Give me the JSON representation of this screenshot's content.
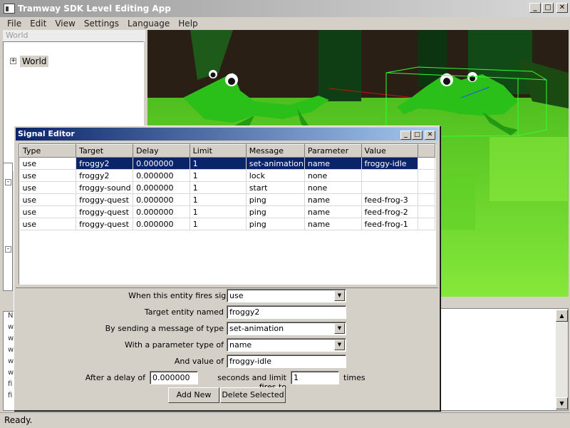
{
  "app": {
    "title": "Tramway SDK Level Editing App",
    "window_buttons": [
      "_",
      "□",
      "✕"
    ]
  },
  "menu": [
    "File",
    "Edit",
    "View",
    "Settings",
    "Language",
    "Help"
  ],
  "world_panel": {
    "title": "World",
    "tree_root": "World",
    "expander": "+"
  },
  "status": "Ready.",
  "dialog": {
    "title": "Signal Editor",
    "buttons": [
      "_",
      "□",
      "✕"
    ],
    "columns": [
      "Type",
      "Target",
      "Delay",
      "Limit",
      "Message",
      "Parameter",
      "Value"
    ],
    "rows": [
      [
        "use",
        "froggy2",
        "0.000000",
        "1",
        "set-animation",
        "name",
        "froggy-idle"
      ],
      [
        "use",
        "froggy2",
        "0.000000",
        "1",
        "lock",
        "none",
        ""
      ],
      [
        "use",
        "froggy-sound",
        "0.000000",
        "1",
        "start",
        "none",
        ""
      ],
      [
        "use",
        "froggy-quest",
        "0.000000",
        "1",
        "ping",
        "name",
        "feed-frog-3"
      ],
      [
        "use",
        "froggy-quest",
        "0.000000",
        "1",
        "ping",
        "name",
        "feed-frog-2"
      ],
      [
        "use",
        "froggy-quest",
        "0.000000",
        "1",
        "ping",
        "name",
        "feed-frog-1"
      ]
    ],
    "selected_row": 0,
    "form": {
      "signal_label": "When this entity fires signal",
      "signal_value": "use",
      "target_label": "Target entity named",
      "target_value": "froggy2",
      "message_label": "By sending a message of type",
      "message_value": "set-animation",
      "param_type_label": "With a parameter type of",
      "param_type_value": "name",
      "value_label": "And value of",
      "value_value": "froggy-idle",
      "delay_label": "After a delay of",
      "delay_value": "0.000000",
      "limit_label": "seconds and limit fires to",
      "limit_value": "1",
      "times_label": "times",
      "add_button": "Add New",
      "delete_button": "Delete Selected"
    }
  }
}
